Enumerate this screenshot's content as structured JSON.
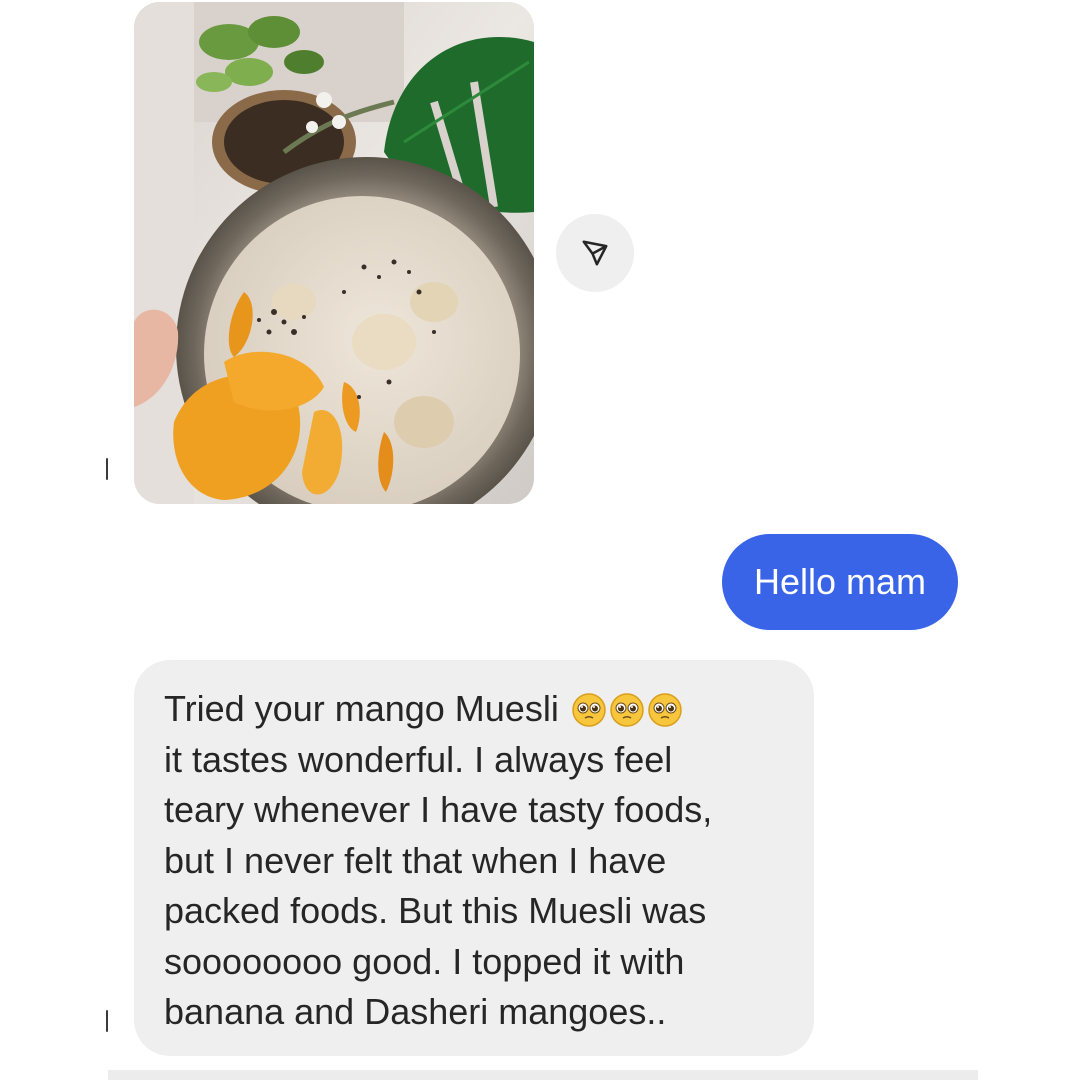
{
  "conversation": {
    "photo_message": {
      "kind": "shared-photo",
      "description_icon": "photo-muesli-bowl"
    },
    "share_icon": "paper-plane-icon",
    "sent_message": {
      "text": "Hello mam"
    },
    "received_message": {
      "lines": [
        "Tried your mango Muesli",
        "it tastes wonderful. I always feel",
        "teary whenever I have tasty foods,",
        "but I never felt that when I have",
        "packed foods. But this Muesli was",
        "soooooooo good. I topped it with",
        "banana and Dasheri mangoes.."
      ],
      "emoji": [
        "pleading-face-icon",
        "pleading-face-icon",
        "pleading-face-icon"
      ]
    }
  },
  "colors": {
    "sent_bubble": "#3a64e7",
    "received_bubble": "#efefef",
    "received_text": "#262626",
    "share_button": "#efefef"
  }
}
